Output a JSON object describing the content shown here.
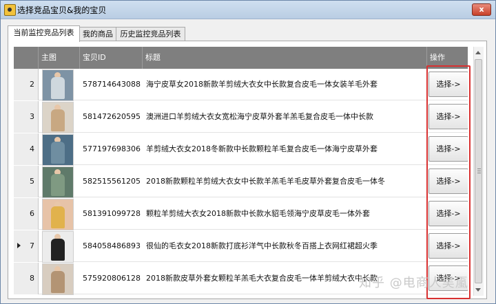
{
  "window": {
    "title": "选择竞品宝贝&我的宝贝",
    "close_label": "x"
  },
  "tabs": [
    {
      "label": "当前监控竞品列表",
      "active": true
    },
    {
      "label": "我的商品",
      "active": false
    },
    {
      "label": "历史监控竞品列表",
      "active": false
    }
  ],
  "table": {
    "columns": [
      "主图",
      "宝贝ID",
      "标题",
      "操作"
    ],
    "rows": [
      {
        "num": "2",
        "id": "578714643088",
        "title": "海宁皮草女2018新款羊剪绒大衣女中长款复合皮毛一体女装羊毛外套",
        "action": "选择->",
        "current": false,
        "thumb_bg": "#7e93a5",
        "thumb_coat": "#cfd8de"
      },
      {
        "num": "3",
        "id": "581472620595",
        "title": "澳洲进口羊剪绒大衣女宽松海宁皮草外套羊羔毛复合皮毛一体中长款",
        "action": "选择->",
        "current": false,
        "thumb_bg": "#dcd4c8",
        "thumb_coat": "#c8a882"
      },
      {
        "num": "4",
        "id": "577197698306",
        "title": "羊剪绒大衣女2018冬新款中长款颗粒羊毛复合皮毛一体海宁皮草外套",
        "action": "选择->",
        "current": false,
        "thumb_bg": "#4d6e86",
        "thumb_coat": "#6f8ea1"
      },
      {
        "num": "5",
        "id": "582515561205",
        "title": "2018新款颗粒羊剪绒大衣女中长款羊羔毛羊毛皮草外套复合皮毛一体冬",
        "action": "选择->",
        "current": false,
        "thumb_bg": "#5f7a6a",
        "thumb_coat": "#7f9a82"
      },
      {
        "num": "6",
        "id": "581391099728",
        "title": "颗粒羊剪绒大衣女2018新款中长款水貂毛领海宁皮草皮毛一体外套",
        "action": "选择->",
        "current": false,
        "thumb_bg": "#e7c3a8",
        "thumb_coat": "#e1b24c"
      },
      {
        "num": "7",
        "id": "584058486893",
        "title": "很仙的毛衣女2018新款打底衫洋气中长款秋冬百搭上衣网红裙超火季",
        "action": "选择->",
        "current": true,
        "thumb_bg": "#ececec",
        "thumb_coat": "#222222"
      },
      {
        "num": "8",
        "id": "575920806128",
        "title": "2018新款皮草外套女颗粒羊羔毛大衣复合皮毛一体羊剪绒大衣中长款",
        "action": "选择->",
        "current": false,
        "thumb_bg": "#d8cdc0",
        "thumb_coat": "#b39474"
      }
    ]
  },
  "watermark": "知乎 @电商人吴颪",
  "colors": {
    "header_bg": "#7f7f7f",
    "highlight": "#d83030"
  }
}
